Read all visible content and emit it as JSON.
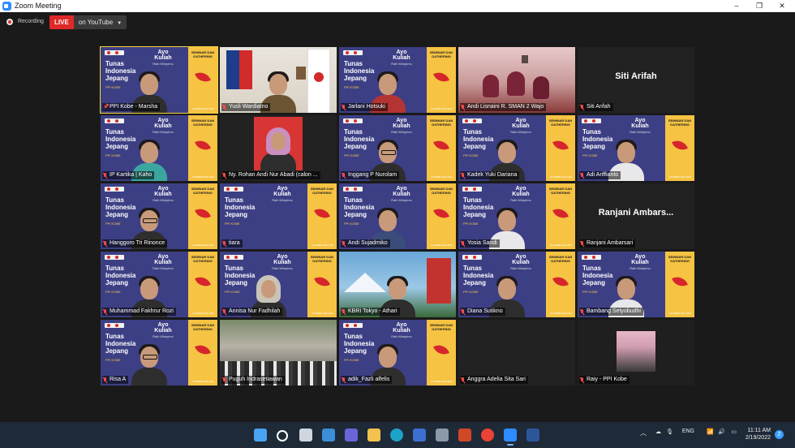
{
  "window": {
    "title": "Zoom Meeting",
    "controls": [
      "–",
      "❐",
      "✕"
    ]
  },
  "recording": {
    "label": "Recording"
  },
  "live": {
    "badge": "LIVE",
    "destination": "on YouTube"
  },
  "banner": {
    "title_lines": [
      "Tunas",
      "Indonesia",
      "Jepang"
    ],
    "ayo": "Ayo Kuliah",
    "ayo_sub": "Raih Mimpimu",
    "seminar": "SEMINAR DAN GATHERING",
    "tag": "PPI KOBE",
    "footer": "20 FEBRUARI 2022"
  },
  "participants": [
    {
      "name": "PPI Kobe - Marsha",
      "bg": "banner",
      "person": "long-hair",
      "active": true,
      "pinned": true
    },
    {
      "name": "Yusli Wardiatno",
      "bg": "office",
      "person": "batik"
    },
    {
      "name": "Jarlani Hotsuki",
      "bg": "banner",
      "person": "red"
    },
    {
      "name": "Andi Lisnaini R. SMAN 2 Wajo",
      "bg": "classroom",
      "person": "group"
    },
    {
      "name": "Siti Arifah",
      "bg": "name",
      "display": "Siti Arifah"
    },
    {
      "name": "IP Kartika | Kaho",
      "bg": "banner",
      "person": "teal"
    },
    {
      "name": "Ny. Rohan Andi Nur Abadi (calon ...",
      "bg": "photo-hijab",
      "person": "hijab"
    },
    {
      "name": "Inggang P Nurolam",
      "bg": "banner",
      "person": "glasses"
    },
    {
      "name": "Kadek Yuki Dariana",
      "bg": "banner",
      "person": "dark"
    },
    {
      "name": "Adi Ariffianto",
      "bg": "banner",
      "person": "white"
    },
    {
      "name": "Hanggoro Tri Rinonce",
      "bg": "banner",
      "person": "glasses"
    },
    {
      "name": "tiara",
      "bg": "banner",
      "person": "none"
    },
    {
      "name": "Andi Sujadmiko",
      "bg": "banner",
      "person": "blue"
    },
    {
      "name": "Yosia Sandi",
      "bg": "banner",
      "person": "white"
    },
    {
      "name": "Ranjani Ambarsari",
      "bg": "name",
      "display": "Ranjani Ambars..."
    },
    {
      "name": "Muhammad Fakhrur Rozi",
      "bg": "banner",
      "person": "dark"
    },
    {
      "name": "Annisa Nur Fadhilah",
      "bg": "banner",
      "person": "hijab"
    },
    {
      "name": "KBRI Tokyo - Athari",
      "bg": "japan",
      "person": "dark"
    },
    {
      "name": "Diana Sutikno",
      "bg": "banner",
      "person": "long-hair"
    },
    {
      "name": "Bambang Setyobudhi",
      "bg": "banner",
      "person": "white"
    },
    {
      "name": "Risa A",
      "bg": "banner",
      "person": "glasses-long"
    },
    {
      "name": "Puguh Indrasetiawan",
      "bg": "crowd",
      "person": "none"
    },
    {
      "name": "adik_Fazli alfelis",
      "bg": "banner",
      "person": "dark"
    },
    {
      "name": "Anggra Adelia Sita Sari",
      "bg": "blank",
      "person": "none"
    },
    {
      "name": "Raiy - PPI Kobe",
      "bg": "avatar",
      "person": "none"
    }
  ],
  "taskbar": {
    "apps": [
      "windows",
      "search",
      "task-view",
      "widgets",
      "teams",
      "file-explorer",
      "edge",
      "store",
      "photos",
      "powerpoint",
      "chrome",
      "zoom",
      "word"
    ],
    "tray_lang": "ENG",
    "time": "11:11 AM",
    "date": "2/19/2022",
    "notifications": "2"
  },
  "colors": {
    "banner_blue": "#3d3f85",
    "banner_yellow": "#f6c342",
    "active_outline": "#f5d33f",
    "live_red": "#e02828",
    "mute_red": "#ff4a4a"
  }
}
